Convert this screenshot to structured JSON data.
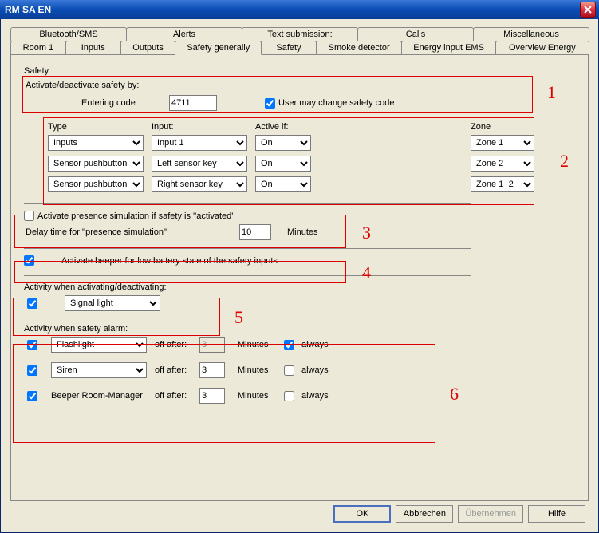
{
  "window": {
    "title": "RM SA EN"
  },
  "tabs": {
    "row1": [
      "Bluetooth/SMS",
      "Alerts",
      "Text submission:",
      "Calls",
      "Miscellaneous"
    ],
    "row2": [
      "Room 1",
      "Inputs",
      "Outputs",
      "Safety generally",
      "Safety",
      "Smoke detector",
      "Energy input EMS",
      "Overview Energy"
    ],
    "active": "Safety generally"
  },
  "safety": {
    "label": "Safety",
    "activate_label": "Activate/deactivate safety by:",
    "entering_code_label": "Entering code",
    "code_value": "4711",
    "user_may_change_label": "User may change safety code",
    "user_may_change_checked": true
  },
  "table": {
    "headers": {
      "type": "Type",
      "input": "Input:",
      "active": "Active if:",
      "zone": "Zone"
    },
    "rows": [
      {
        "type": "Inputs",
        "input": "Input 1",
        "active": "On",
        "zone": "Zone 1"
      },
      {
        "type": "Sensor pushbutton",
        "input": "Left sensor key",
        "active": "On",
        "zone": "Zone 2"
      },
      {
        "type": "Sensor pushbutton",
        "input": "Right sensor key",
        "active": "On",
        "zone": "Zone 1+2"
      }
    ]
  },
  "presence": {
    "activate_label": "Activate presence simulation if safety is ''activated''",
    "activate_checked": false,
    "delay_label": "Delay time for ''presence simulation''",
    "delay_value": "10",
    "minutes_label": "Minutes"
  },
  "beeper": {
    "label": "Activate beeper for low battery state of the safety inputs",
    "checked": true
  },
  "activity_act": {
    "label": "Activity when activating/deactivating:",
    "checked": true,
    "value": "Signal light"
  },
  "alarm": {
    "label": "Activity when safety alarm:",
    "off_after": "off after:",
    "minutes": "Minutes",
    "always": "always",
    "rows": [
      {
        "checked": true,
        "device": "Flashlight",
        "is_select": true,
        "num": "3",
        "num_disabled": true,
        "always_checked": true
      },
      {
        "checked": true,
        "device": "Siren",
        "is_select": true,
        "num": "3",
        "num_disabled": false,
        "always_checked": false
      },
      {
        "checked": true,
        "device": "Beeper Room-Manager",
        "is_select": false,
        "num": "3",
        "num_disabled": false,
        "always_checked": false
      }
    ]
  },
  "buttons": {
    "ok": "OK",
    "cancel": "Abbrechen",
    "apply": "Übernehmen",
    "help": "Hilfe"
  },
  "annotations": [
    "1",
    "2",
    "3",
    "4",
    "5",
    "6"
  ]
}
